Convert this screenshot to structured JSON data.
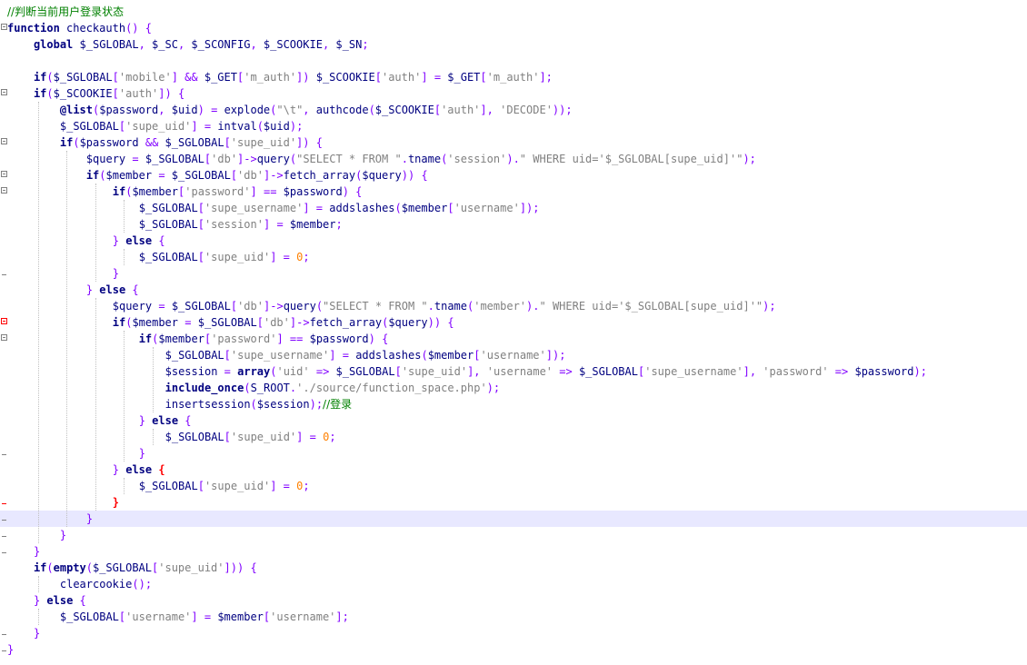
{
  "editor": {
    "lines": [
      "//判断当前用户登录状态",
      "function checkauth() {",
      "    global $_SGLOBAL, $_SC, $_SCONFIG, $_SCOOKIE, $_SN;",
      "",
      "    if($_SGLOBAL['mobile'] && $_GET['m_auth']) $_SCOOKIE['auth'] = $_GET['m_auth'];",
      "    if($_SCOOKIE['auth']) {",
      "        @list($password, $uid) = explode(\"\\t\", authcode($_SCOOKIE['auth'], 'DECODE'));",
      "        $_SGLOBAL['supe_uid'] = intval($uid);",
      "        if($password && $_SGLOBAL['supe_uid']) {",
      "            $query = $_SGLOBAL['db']->query(\"SELECT * FROM \".tname('session').\" WHERE uid='$_SGLOBAL[supe_uid]'\");",
      "            if($member = $_SGLOBAL['db']->fetch_array($query)) {",
      "                if($member['password'] == $password) {",
      "                    $_SGLOBAL['supe_username'] = addslashes($member['username']);",
      "                    $_SGLOBAL['session'] = $member;",
      "                } else {",
      "                    $_SGLOBAL['supe_uid'] = 0;",
      "                }",
      "            } else {",
      "                $query = $_SGLOBAL['db']->query(\"SELECT * FROM \".tname('member').\" WHERE uid='$_SGLOBAL[supe_uid]'\");",
      "                if($member = $_SGLOBAL['db']->fetch_array($query)) {",
      "                    if($member['password'] == $password) {",
      "                        $_SGLOBAL['supe_username'] = addslashes($member['username']);",
      "                        $session = array('uid' => $_SGLOBAL['supe_uid'], 'username' => $_SGLOBAL['supe_username'], 'password' => $password);",
      "                        include_once(S_ROOT.'./source/function_space.php');",
      "                        insertsession($session);//登录",
      "                    } else {",
      "                        $_SGLOBAL['supe_uid'] = 0;",
      "                    }",
      "                } else {",
      "                    $_SGLOBAL['supe_uid'] = 0;",
      "                }",
      "            }",
      "        }",
      "    }",
      "    if(empty($_SGLOBAL['supe_uid'])) {",
      "        clearcookie();",
      "    } else {",
      "        $_SGLOBAL['username'] = $member['username'];",
      "    }",
      "}"
    ],
    "current_line": 31,
    "colors": {
      "keyword": "#000080",
      "string": "#808080",
      "number": "#ff8000",
      "comment": "#008000",
      "current_line_bg": "#e8e8ff",
      "fold_marker": "#808080",
      "fold_marker_active": "#ff0000"
    }
  }
}
